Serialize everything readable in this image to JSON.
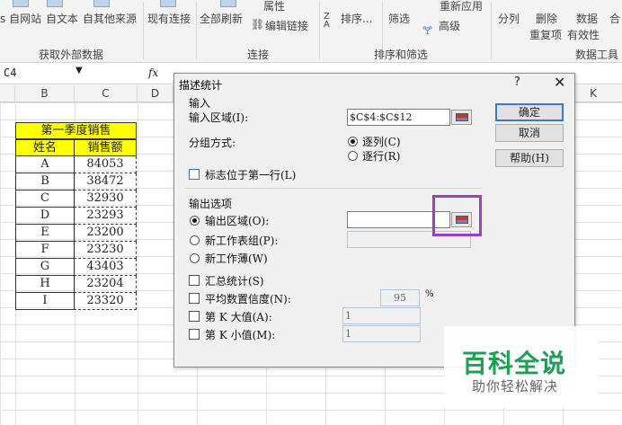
{
  "ribbon": {
    "buttons": [
      "s 自网站",
      "自文本",
      "自其他来源",
      "现有连接",
      "全部刷新",
      "属性",
      "编辑链接",
      "排序...",
      "筛选",
      "重新应用",
      "高级",
      "分列",
      "删除",
      "重复项",
      "数据",
      "有效性",
      "合"
    ],
    "groups": [
      "获取外部数据",
      "连接",
      "排序和筛选",
      "数据工具"
    ]
  },
  "formula_bar": {
    "name_box": "C4",
    "fx": "fx"
  },
  "columns": [
    "B",
    "C",
    "D",
    "K"
  ],
  "table": {
    "title": "第一季度销售",
    "headers": [
      "姓名",
      "销售额"
    ],
    "rows": [
      [
        "A",
        "84053"
      ],
      [
        "B",
        "38472"
      ],
      [
        "C",
        "32930"
      ],
      [
        "D",
        "23293"
      ],
      [
        "E",
        "23200"
      ],
      [
        "F",
        "23230"
      ],
      [
        "G",
        "43403"
      ],
      [
        "H",
        "23204"
      ],
      [
        "I",
        "23320"
      ]
    ]
  },
  "dialog": {
    "title": "描述统计",
    "help": "?",
    "close": "✕",
    "input_section": "输入",
    "input_range_label": "输入区域(I):",
    "input_range_value": "$C$4:$C$12",
    "group_by_label": "分组方式:",
    "by_column": "逐列(C)",
    "by_row": "逐行(R)",
    "labels_first_row": "标志位于第一行(L)",
    "output_section": "输出选项",
    "output_range": "输出区域(O):",
    "new_sheet": "新工作表组(P):",
    "new_workbook": "新工作薄(W)",
    "summary_stats": "汇总统计(S)",
    "confidence": "平均数置信度(N):",
    "confidence_value": "95",
    "percent": "%",
    "kth_largest": "第 K 大值(A):",
    "kth_largest_value": "1",
    "kth_smallest": "第 K 小值(M):",
    "kth_smallest_value": "1",
    "ok": "确定",
    "cancel": "取消",
    "help_btn": "帮助(H)"
  },
  "watermark": {
    "main": "百科全说",
    "sub": "助你轻松解决"
  }
}
